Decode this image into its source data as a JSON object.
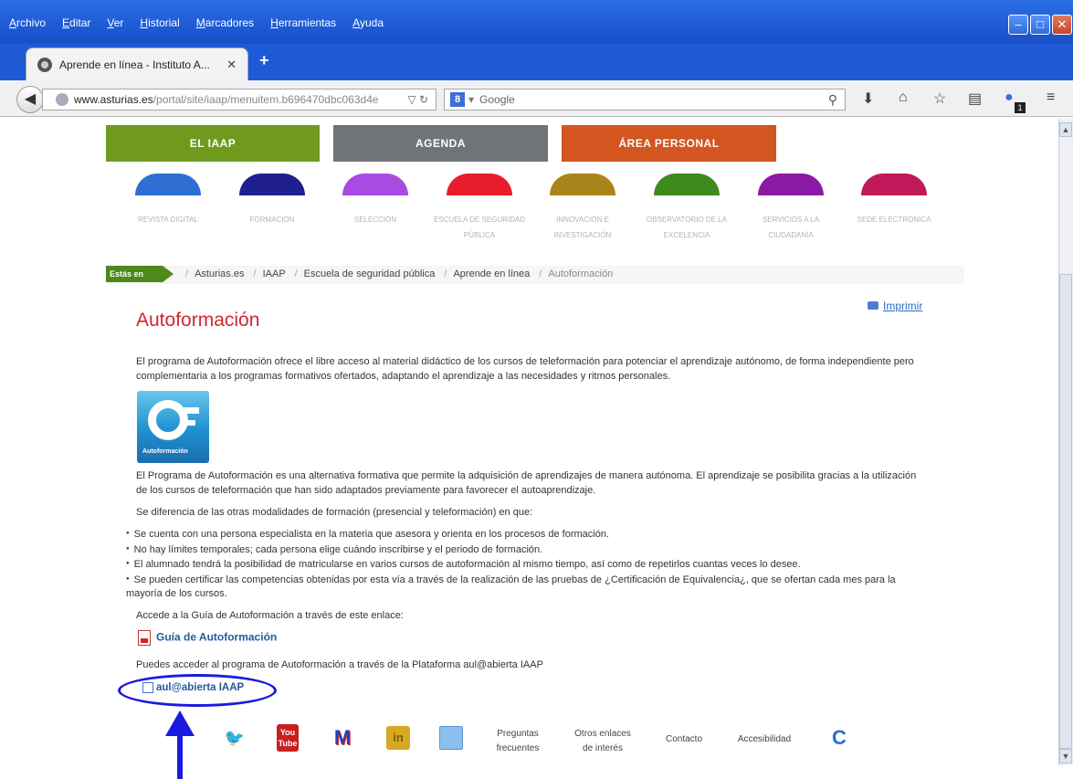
{
  "menubar": [
    "Archivo",
    "Editar",
    "Ver",
    "Historial",
    "Marcadores",
    "Herramientas",
    "Ayuda"
  ],
  "tab": {
    "title": "Aprende en línea - Instituto A...",
    "close": "✕",
    "new": "+"
  },
  "url": {
    "host": "www.asturias.es",
    "path": "/portal/site/iaap/menuitem.b696470dbc063d4e"
  },
  "search": {
    "engine": "8",
    "placeholder": "Google"
  },
  "addon_badge": "1",
  "topnav": [
    {
      "label": "EL IAAP",
      "color": "#6f9a1e"
    },
    {
      "label": "AGENDA",
      "color": "#6f7478"
    },
    {
      "label": "ÁREA PERSONAL",
      "color": "#d3551f"
    }
  ],
  "sections": [
    {
      "label": "REVISTA DIGITAL",
      "color": "#2f6fd3"
    },
    {
      "label": "FORMACIÓN",
      "color": "#1f1f8f"
    },
    {
      "label": "SELECCIÓN",
      "color": "#a84be3"
    },
    {
      "label": "ESCUELA DE SEGURIDAD PÚBLICA",
      "color": "#e81c2c"
    },
    {
      "label": "INNOVACIÓN E INVESTIGACIÓN",
      "color": "#a8841a"
    },
    {
      "label": "OBSERVATORIO DE LA EXCELENCIA",
      "color": "#3f8a1e"
    },
    {
      "label": "SERVICIOS A LA CIUDADANÍA",
      "color": "#8a1aa3"
    },
    {
      "label": "SEDE ELECTRÓNICA",
      "color": "#c01a5a"
    }
  ],
  "breadcrumb": {
    "label": "Estás en",
    "items": [
      "Asturias.es",
      "IAAP",
      "Escuela de seguridad pública",
      "Aprende en línea"
    ],
    "current": "Autoformación"
  },
  "print_label": "Imprimir",
  "page_title": "Autoformación",
  "intro": "El programa de Autoformación ofrece el libre acceso al material didáctico de los cursos de teleformación para potenciar el aprendizaje autónomo, de forma independiente pero complementaria a los programas formativos ofertados, adaptando el aprendizaje a las necesidades y ritmos personales.",
  "logo_text": "Autoformación",
  "desc": "El Programa de Autoformación es una alternativa formativa que permite la adquisición de aprendizajes de manera autónoma. El aprendizaje se posibilita gracias a la utilización de los cursos de teleformación que han sido adaptados previamente para favorecer el autoaprendizaje.",
  "diff": "Se diferencia de las otras modalidades de formación (presencial y teleformación) en que:",
  "bullets": [
    "Se cuenta con una persona especialista en la materia que asesora y orienta en los procesos de formación.",
    "No hay límites temporales; cada persona elige cuándo inscribirse y el periodo de formación.",
    "El alumnado tendrá la posibilidad de matricularse en varios cursos de autoformación al mismo tiempo, así como de repetirlos cuantas veces lo desee.",
    "Se pueden certificar las competencias obtenidas por esta vía a través de la realización de las pruebas de ¿Certificación de Equivalencia¿, que se ofertan cada mes para la mayoría de los cursos."
  ],
  "guide_text": "Accede a la Guía de Autoformación a través de este enlace:",
  "guide_link": "Guía de Autoformación",
  "platform_text": "Puedes acceder al programa de Autoformación a través de la Plataforma aul@abierta IAAP",
  "platform_link": "aul@abierta IAAP",
  "footer": {
    "youtube": [
      "You",
      "Tube"
    ],
    "m": "M",
    "in": "in",
    "faq": [
      "Preguntas",
      "frecuentes"
    ],
    "other": [
      "Otros enlaces",
      "de interés"
    ],
    "contact": "Contacto",
    "access": "Accesibilidad",
    "c": "C"
  }
}
